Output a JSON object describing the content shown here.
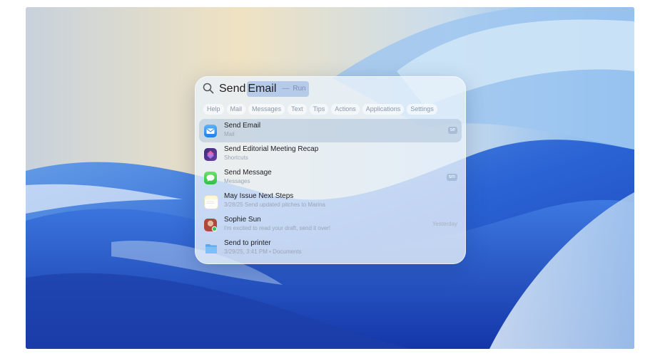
{
  "search": {
    "typed": "Send ",
    "completion": "Email",
    "separator": "—",
    "action": "Run"
  },
  "filters": [
    "Help",
    "Mail",
    "Messages",
    "Text",
    "Tips",
    "Actions",
    "Applications",
    "Settings"
  ],
  "results": [
    {
      "title": "Send Email",
      "subtitle": "Mail",
      "badge": "se",
      "meta": "",
      "icon": "mail-icon"
    },
    {
      "title": "Send Editorial Meeting Recap",
      "subtitle": "Shortcuts",
      "badge": "",
      "meta": "",
      "icon": "shortcuts-icon"
    },
    {
      "title": "Send Message",
      "subtitle": "Messages",
      "badge": "sm",
      "meta": "",
      "icon": "messages-icon"
    },
    {
      "title": "May Issue Next Steps",
      "subtitle": "3/28/25 Send updated pitches to Marina",
      "badge": "",
      "meta": "",
      "icon": "notes-icon"
    },
    {
      "title": "Sophie Sun",
      "subtitle": "I'm excited to read your draft, send it over!",
      "badge": "",
      "meta": "Yesterday",
      "icon": "contact-avatar-icon"
    },
    {
      "title": "Send to printer",
      "subtitle": "3/29/25, 3:41 PM • Documents",
      "badge": "",
      "meta": "",
      "icon": "folder-icon"
    }
  ],
  "colors": {
    "accent": "#1f7de6",
    "selection": "#96afcd",
    "panel": "#e8f1fa"
  }
}
